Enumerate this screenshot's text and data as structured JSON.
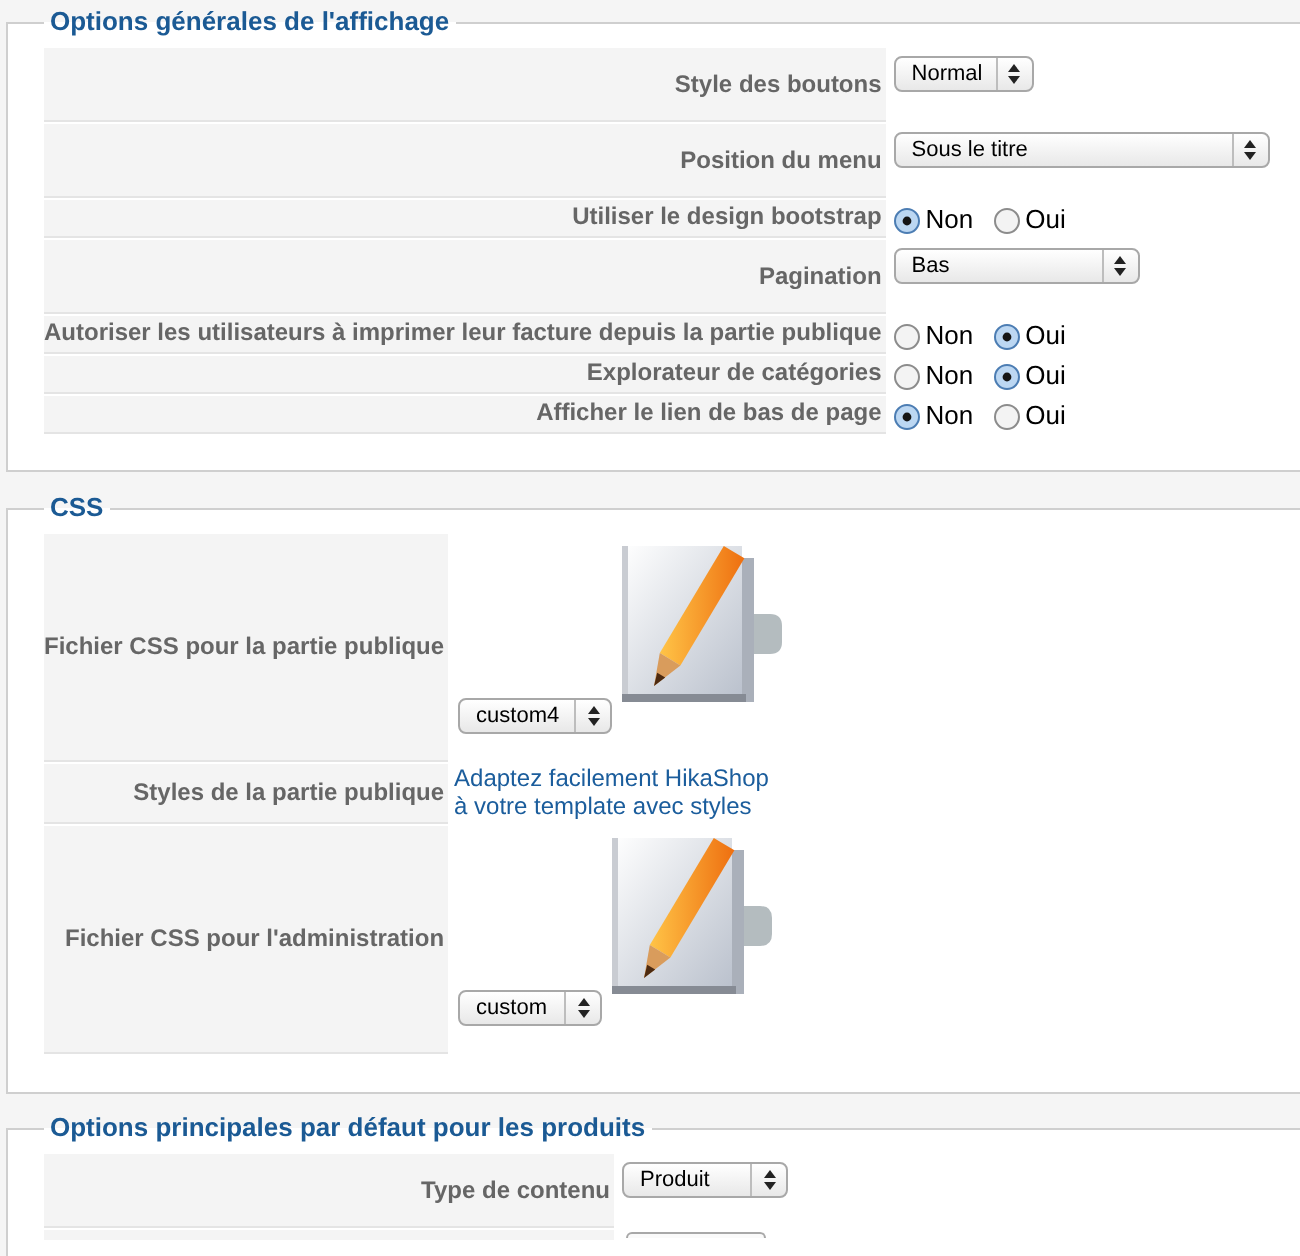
{
  "sections": [
    {
      "title": "Options générales de l'affichage",
      "rows": [
        {
          "kind": "select",
          "label": "Style des boutons",
          "value": "Normal"
        },
        {
          "kind": "select",
          "label": "Position du menu",
          "value": "Sous le titre"
        },
        {
          "kind": "radio",
          "label": "Utiliser le design bootstrap",
          "options": [
            {
              "label": "Non",
              "selected": true
            },
            {
              "label": "Oui",
              "selected": false
            }
          ]
        },
        {
          "kind": "select",
          "label": "Pagination",
          "value": "Bas"
        },
        {
          "kind": "radio",
          "label": "Autoriser les utilisateurs à imprimer leur facture depuis la partie publique",
          "options": [
            {
              "label": "Non",
              "selected": false
            },
            {
              "label": "Oui",
              "selected": true
            }
          ]
        },
        {
          "kind": "radio",
          "label": "Explorateur de catégories",
          "options": [
            {
              "label": "Non",
              "selected": false
            },
            {
              "label": "Oui",
              "selected": true
            }
          ]
        },
        {
          "kind": "radio",
          "label": "Afficher le lien de bas de page",
          "options": [
            {
              "label": "Non",
              "selected": true
            },
            {
              "label": "Oui",
              "selected": false
            }
          ]
        }
      ]
    },
    {
      "title": "CSS",
      "rows": [
        {
          "kind": "file",
          "label": "Fichier CSS pour la partie publique",
          "value": "custom4"
        },
        {
          "kind": "link",
          "label": "Styles de la partie publique",
          "link": "Adaptez facilement HikaShop à votre template avec styles"
        },
        {
          "kind": "file",
          "label": "Fichier CSS pour l'administration",
          "value": "custom"
        }
      ]
    },
    {
      "title": "Options principales par défaut pour les produits",
      "rows": [
        {
          "kind": "select",
          "label": "Type de contenu",
          "value": "Produit"
        },
        {
          "kind": "select"
        }
      ]
    }
  ]
}
